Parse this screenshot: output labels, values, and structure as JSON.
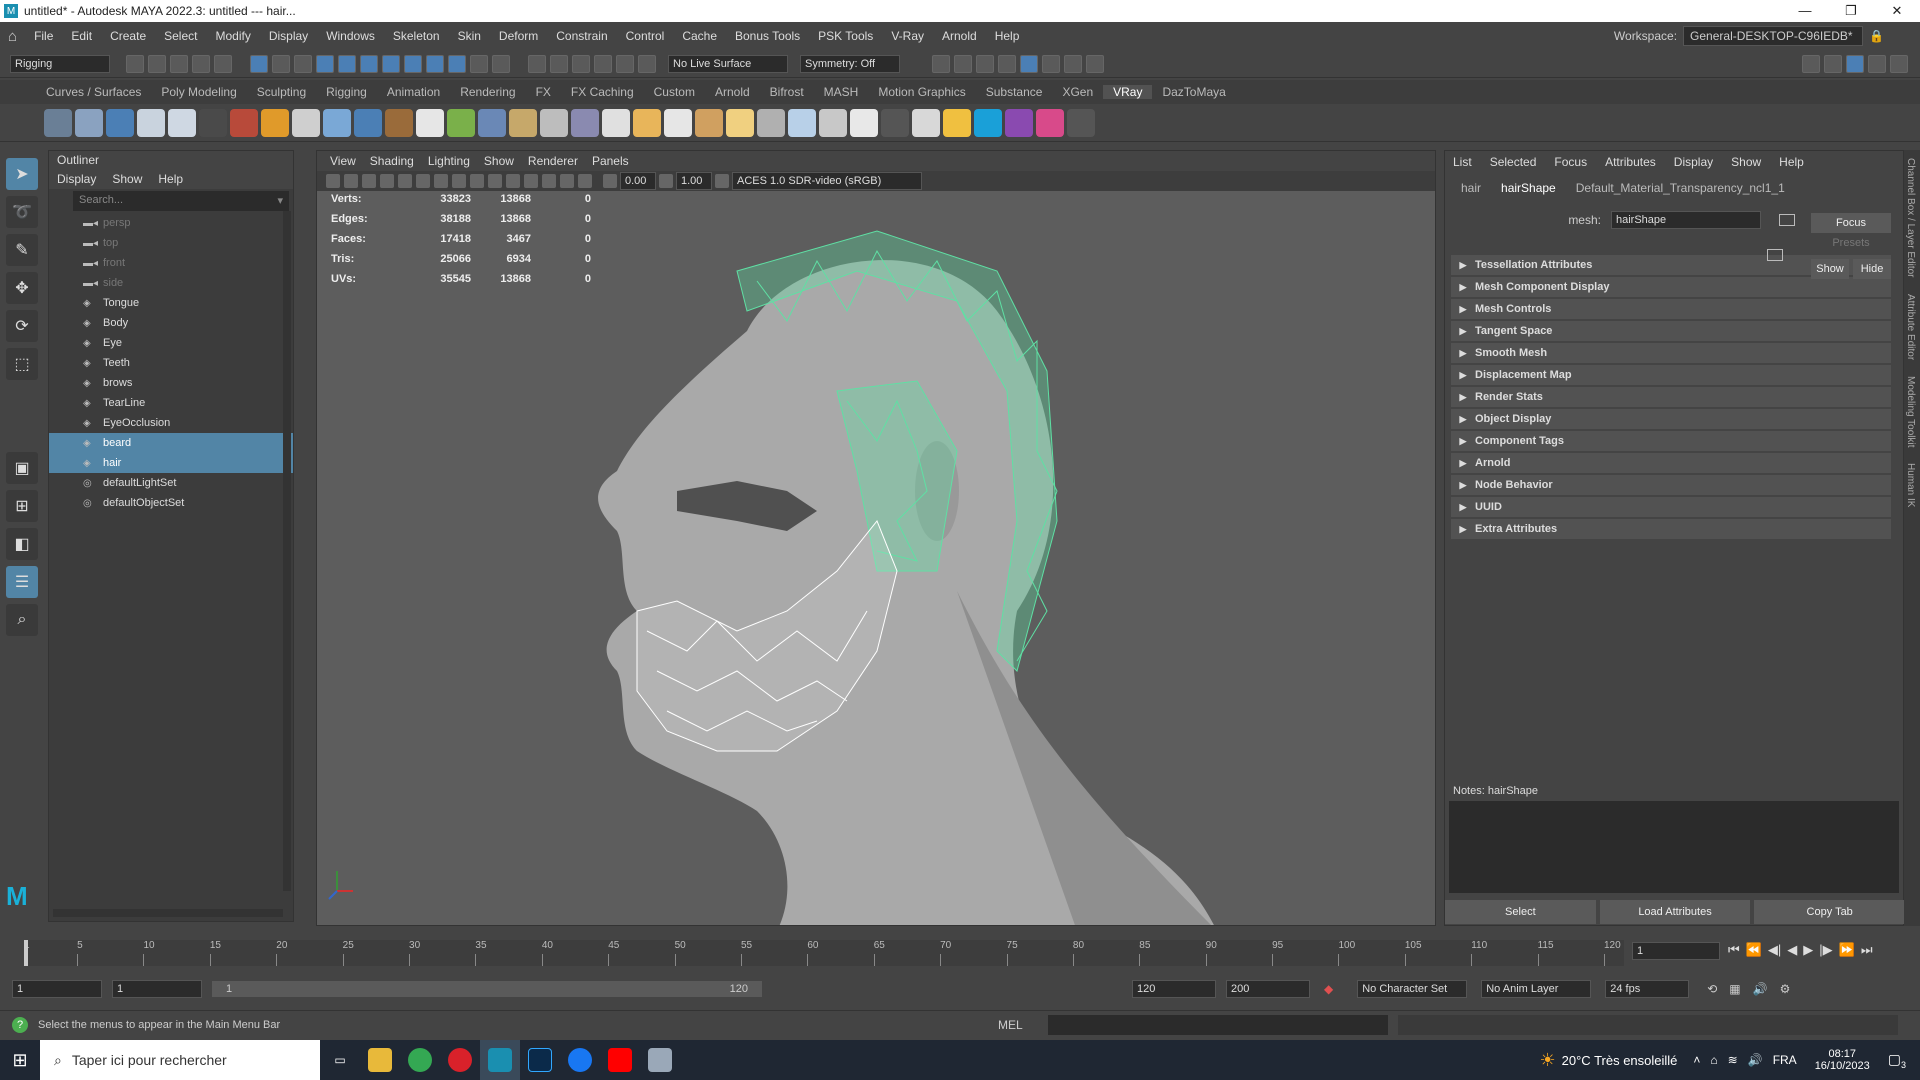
{
  "window": {
    "title": "untitled* - Autodesk MAYA 2022.3: untitled   ---   hair..."
  },
  "menus": [
    "File",
    "Edit",
    "Create",
    "Select",
    "Modify",
    "Display",
    "Windows",
    "Skeleton",
    "Skin",
    "Deform",
    "Constrain",
    "Control",
    "Cache",
    "Bonus Tools",
    "PSK Tools",
    "V-Ray",
    "Arnold",
    "Help"
  ],
  "workspace": {
    "label": "Workspace:",
    "value": "General-DESKTOP-C96IEDB*"
  },
  "statusline": {
    "menuset": "Rigging",
    "live_surface": "No Live Surface",
    "symmetry": "Symmetry: Off"
  },
  "shelf_tabs": [
    "Curves / Surfaces",
    "Poly Modeling",
    "Sculpting",
    "Rigging",
    "Animation",
    "Rendering",
    "FX",
    "FX Caching",
    "Custom",
    "Arnold",
    "Bifrost",
    "MASH",
    "Motion Graphics",
    "Substance",
    "XGen",
    "VRay",
    "DazToMaya"
  ],
  "shelf_active": "VRay",
  "outliner": {
    "title": "Outliner",
    "menu": [
      "Display",
      "Show",
      "Help"
    ],
    "search_placeholder": "Search...",
    "items": [
      {
        "name": "persp",
        "kind": "camera",
        "dim": true,
        "selected": false
      },
      {
        "name": "top",
        "kind": "camera",
        "dim": true,
        "selected": false
      },
      {
        "name": "front",
        "kind": "camera",
        "dim": true,
        "selected": false
      },
      {
        "name": "side",
        "kind": "camera",
        "dim": true,
        "selected": false
      },
      {
        "name": "Tongue",
        "kind": "mesh",
        "dim": false,
        "selected": false
      },
      {
        "name": "Body",
        "kind": "mesh",
        "dim": false,
        "selected": false
      },
      {
        "name": "Eye",
        "kind": "mesh",
        "dim": false,
        "selected": false
      },
      {
        "name": "Teeth",
        "kind": "mesh",
        "dim": false,
        "selected": false
      },
      {
        "name": "brows",
        "kind": "mesh",
        "dim": false,
        "selected": false
      },
      {
        "name": "TearLine",
        "kind": "mesh",
        "dim": false,
        "selected": false
      },
      {
        "name": "EyeOcclusion",
        "kind": "mesh",
        "dim": false,
        "selected": false
      },
      {
        "name": "beard",
        "kind": "mesh",
        "dim": false,
        "selected": true
      },
      {
        "name": "hair",
        "kind": "mesh",
        "dim": false,
        "selected": true
      },
      {
        "name": "defaultLightSet",
        "kind": "set",
        "dim": false,
        "selected": false
      },
      {
        "name": "defaultObjectSet",
        "kind": "set",
        "dim": false,
        "selected": false
      }
    ]
  },
  "viewport": {
    "menu": [
      "View",
      "Shading",
      "Lighting",
      "Show",
      "Renderer",
      "Panels"
    ],
    "exposure": "0.00",
    "gamma": "1.00",
    "colorspace": "ACES 1.0 SDR-video (sRGB)",
    "hud": [
      {
        "label": "Verts:",
        "v1": "33823",
        "v2": "13868",
        "v3": "0"
      },
      {
        "label": "Edges:",
        "v1": "38188",
        "v2": "13868",
        "v3": "0"
      },
      {
        "label": "Faces:",
        "v1": "17418",
        "v2": "3467",
        "v3": "0"
      },
      {
        "label": "Tris:",
        "v1": "25066",
        "v2": "6934",
        "v3": "0"
      },
      {
        "label": "UVs:",
        "v1": "35545",
        "v2": "13868",
        "v3": "0"
      }
    ]
  },
  "attribute_editor": {
    "menu": [
      "List",
      "Selected",
      "Focus",
      "Attributes",
      "Display",
      "Show",
      "Help"
    ],
    "tabs": [
      "hair",
      "hairShape",
      "Default_Material_Transparency_ncl1_1"
    ],
    "active_tab": "hairShape",
    "mesh_label": "mesh:",
    "mesh_value": "hairShape",
    "focus": "Focus",
    "presets": "Presets",
    "show": "Show",
    "hide": "Hide",
    "sections": [
      "Tessellation Attributes",
      "Mesh Component Display",
      "Mesh Controls",
      "Tangent Space",
      "Smooth Mesh",
      "Displacement Map",
      "Render Stats",
      "Object Display",
      "Component Tags",
      "Arnold",
      "Node Behavior",
      "UUID",
      "Extra Attributes"
    ],
    "notes_label": "Notes:  hairShape",
    "buttons": [
      "Select",
      "Load Attributes",
      "Copy Tab"
    ]
  },
  "side_tabs": [
    "Channel Box / Layer Editor",
    "Attribute Editor",
    "Modeling Toolkit",
    "Human IK"
  ],
  "timeline": {
    "ticks": [
      "1",
      "5",
      "10",
      "15",
      "20",
      "25",
      "30",
      "35",
      "40",
      "45",
      "50",
      "55",
      "60",
      "65",
      "70",
      "75",
      "80",
      "85",
      "90",
      "95",
      "100",
      "105",
      "110",
      "115",
      "120"
    ],
    "current_frame": "1"
  },
  "range": {
    "start": "1",
    "playback_start": "1",
    "range_start": "1",
    "range_end": "120",
    "playback_end": "120",
    "end": "200",
    "character_set": "No Character Set",
    "anim_layer": "No Anim Layer",
    "fps": "24 fps"
  },
  "commandline": {
    "help": "Select the menus to appear in the Main Menu Bar",
    "lang": "MEL"
  },
  "taskbar": {
    "search": "Taper ici pour rechercher",
    "weather": "20°C  Très ensoleillé",
    "lang": "FRA",
    "time": "08:17",
    "date": "16/10/2023",
    "notif": "3"
  },
  "colors": {
    "selection": "#5285a6",
    "hair_wire": "#5fe0a4",
    "beard_wire": "#ffffff"
  }
}
